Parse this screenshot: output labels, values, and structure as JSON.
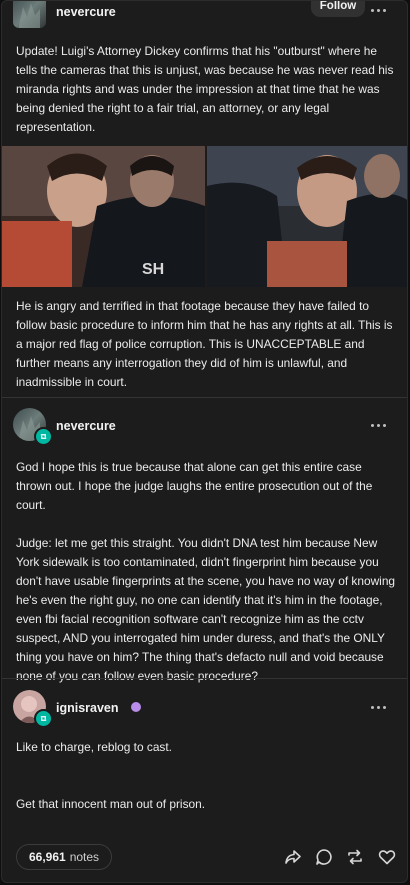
{
  "post": {
    "author": "nevercure",
    "follow_label": "Follow",
    "text": "Update! Luigi's Attorney Dickey confirms that his \"outburst\" where he tells the cameras that this is unjust, was because he was never read his miranda rights and was under the impression at that time that he was being denied the right to a fair trial, an attorney, or any legal representation.",
    "images": [
      {
        "name": "photo-left",
        "overlay_text": "SH"
      },
      {
        "name": "photo-right",
        "overlay_text": ""
      }
    ],
    "text2": "He is angry and terrified in that footage because they have failed to follow basic procedure to inform him that he has any rights at all. This is a major red flag of police corruption. This is UNACCEPTABLE and further means any interrogation they did of him is unlawful, and inadmissible in court."
  },
  "reblog1": {
    "author": "nevercure",
    "paragraph1": "God I hope this is true because that alone can get this entire case thrown out. I hope the judge laughs the entire prosecution out of the court.",
    "paragraph2": "Judge: let me get this straight. You didn't DNA test him because New York sidewalk is too contaminated, didn't fingerprint him because you don't have usable fingerprints at the scene, you have no way of knowing he's even the right guy, no one can identify that it's him in the footage, even fbi facial recognition software can't recognize him as the cctv suspect, AND you interrogated him under duress, and that's the ONLY thing you have on him? The thing that's defacto null and void because none of you can follow even basic procedure?"
  },
  "reblog2": {
    "author": "ignisraven",
    "paragraph1": "Like to charge, reblog to cast.",
    "paragraph2": "Get that innocent man out of prison."
  },
  "footer": {
    "notes_count": "66,961",
    "notes_label": "notes"
  },
  "colors": {
    "background": "#1c1c1c",
    "reblog_badge": "#00b8a2",
    "text": "#ececec",
    "badge_purple": "#b98de8"
  },
  "icons": [
    "more-dots-icon",
    "reblog-badge-icon",
    "share-icon",
    "reply-icon",
    "reblog-icon",
    "heart-icon",
    "verified-badge-icon"
  ]
}
